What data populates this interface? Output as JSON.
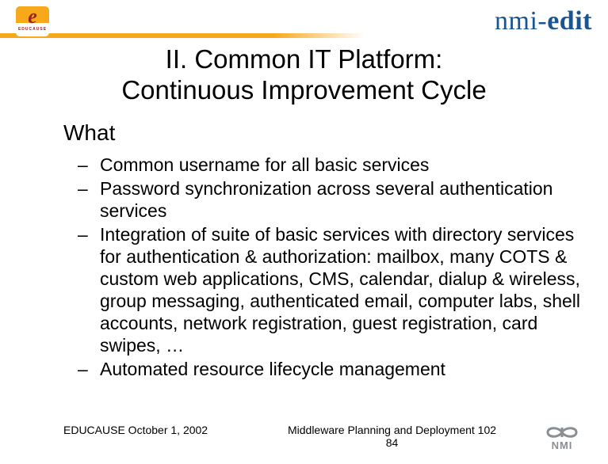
{
  "header": {
    "educause_initial": "e",
    "educause_label": "EDUCAUSE",
    "brand_prefix": "nmi-",
    "brand_suffix": "edit"
  },
  "title_line1": "II. Common IT Platform:",
  "title_line2": "Continuous Improvement Cycle",
  "section_heading": "What",
  "bullets": {
    "b1": "Common username for all basic services",
    "b2": "Password synchronization across several authentication services",
    "b3": "Integration of suite of basic services with directory services for authentication & authorization: mailbox, many COTS & custom web applications, CMS, calendar, dialup & wireless, group messaging, authenticated email, computer labs, shell accounts, network registration, guest registration, card swipes, …",
    "b4": "Automated resource lifecycle management"
  },
  "footer": {
    "left": "EDUCAUSE October 1, 2002",
    "center_line1": "Middleware Planning and Deployment 102",
    "center_line2": "84",
    "nmi_label": "NMI"
  }
}
